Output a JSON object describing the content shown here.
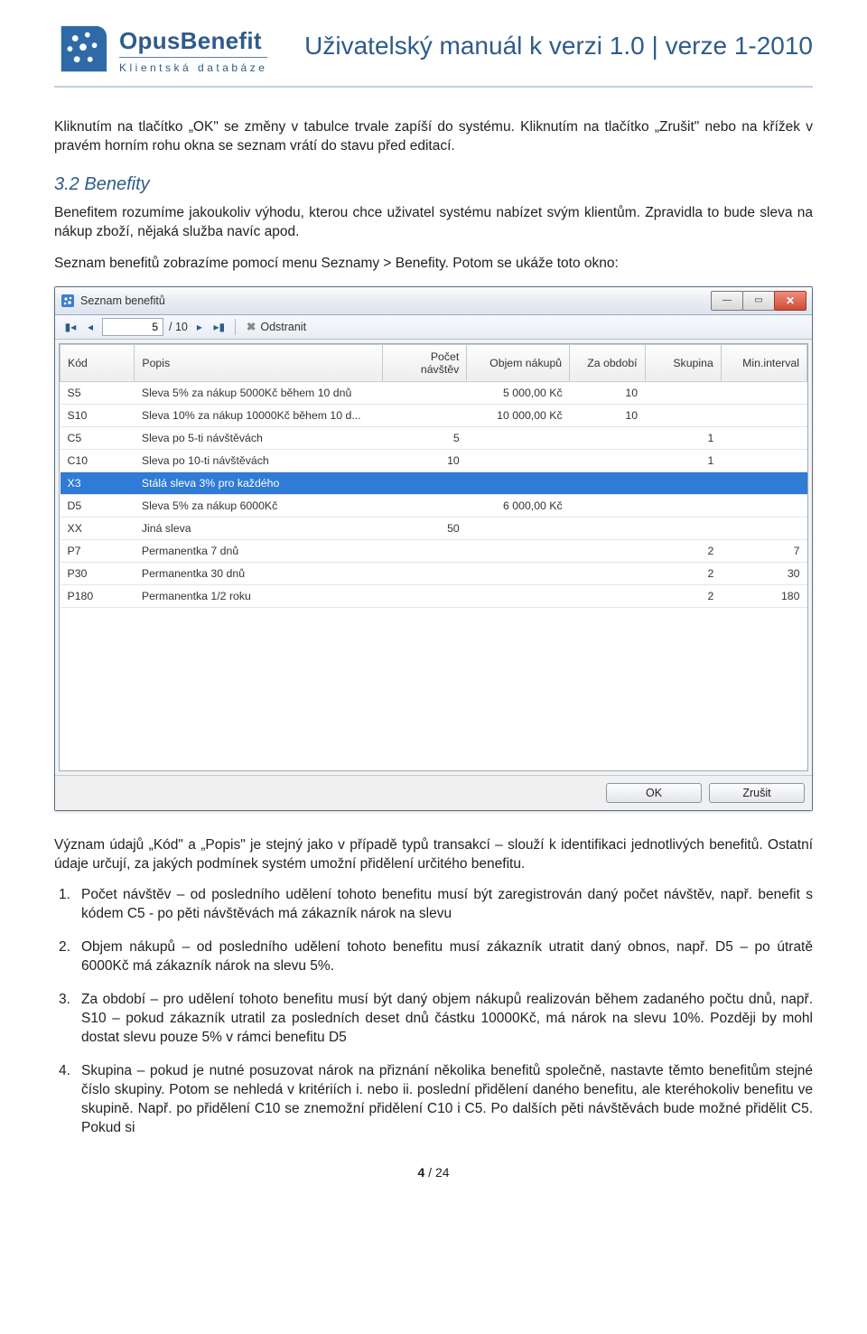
{
  "header": {
    "logo_title": "OpusBenefit",
    "logo_sub": "Klientská databáze",
    "doc_title": "Uživatelský manuál k verzi 1.0 | verze 1-2010"
  },
  "intro_p": "Kliknutím na tlačítko „OK\" se změny v tabulce trvale zapíší do systému. Kliknutím na tlačítko „Zrušit\" nebo na křížek v pravém horním rohu okna se seznam vrátí do stavu před editací.",
  "section": {
    "heading": "3.2 Benefity",
    "p1": "Benefitem rozumíme jakoukoliv výhodu, kterou chce uživatel systému nabízet svým klientům. Zpravidla to bude sleva na nákup zboží, nějaká služba navíc apod.",
    "p2": "Seznam benefitů zobrazíme pomocí menu Seznamy > Benefity. Potom se ukáže toto okno:"
  },
  "window": {
    "title": "Seznam benefitů",
    "nav": {
      "page_value": "5",
      "page_total": "/ 10",
      "remove_label": "Odstranit"
    },
    "columns": [
      "Kód",
      "Popis",
      "Počet návštěv",
      "Objem nákupů",
      "Za období",
      "Skupina",
      "Min.interval"
    ],
    "rows": [
      {
        "kod": "S5",
        "popis": "Sleva 5% za nákup 5000Kč během 10 dnů",
        "pocet": "",
        "objem": "5 000,00 Kč",
        "za": "10",
        "sk": "",
        "min": ""
      },
      {
        "kod": "S10",
        "popis": "Sleva 10% za nákup 10000Kč během 10 d...",
        "pocet": "",
        "objem": "10 000,00 Kč",
        "za": "10",
        "sk": "",
        "min": ""
      },
      {
        "kod": "C5",
        "popis": "Sleva po 5-ti návštěvách",
        "pocet": "5",
        "objem": "",
        "za": "",
        "sk": "1",
        "min": ""
      },
      {
        "kod": "C10",
        "popis": "Sleva po 10-ti návštěvách",
        "pocet": "10",
        "objem": "",
        "za": "",
        "sk": "1",
        "min": ""
      },
      {
        "kod": "X3",
        "popis": "Stálá sleva 3% pro každého",
        "pocet": "",
        "objem": "",
        "za": "",
        "sk": "",
        "min": "",
        "selected": true
      },
      {
        "kod": "D5",
        "popis": "Sleva 5% za nákup 6000Kč",
        "pocet": "",
        "objem": "6 000,00 Kč",
        "za": "",
        "sk": "",
        "min": ""
      },
      {
        "kod": "XX",
        "popis": "Jiná sleva",
        "pocet": "50",
        "objem": "",
        "za": "",
        "sk": "",
        "min": ""
      },
      {
        "kod": "P7",
        "popis": "Permanentka 7 dnů",
        "pocet": "",
        "objem": "",
        "za": "",
        "sk": "2",
        "min": "7"
      },
      {
        "kod": "P30",
        "popis": "Permanentka 30 dnů",
        "pocet": "",
        "objem": "",
        "za": "",
        "sk": "2",
        "min": "30"
      },
      {
        "kod": "P180",
        "popis": "Permanentka 1/2 roku",
        "pocet": "",
        "objem": "",
        "za": "",
        "sk": "2",
        "min": "180"
      }
    ],
    "ok_label": "OK",
    "cancel_label": "Zrušit"
  },
  "after_p": "Význam údajů „Kód\" a „Popis\" je stejný jako v případě typů transakcí – slouží k identifikaci jednotlivých benefitů. Ostatní údaje určují, za jakých podmínek systém umožní přidělení určitého benefitu.",
  "list": [
    "Počet návštěv – od posledního udělení tohoto benefitu musí být zaregistrován daný počet návštěv, např. benefit s kódem C5 - po pěti návštěvách má zákazník nárok na slevu",
    "Objem nákupů – od posledního udělení tohoto benefitu musí zákazník utratit daný obnos, např. D5 – po útratě 6000Kč má zákazník nárok na slevu 5%.",
    "Za období – pro udělení tohoto benefitu musí být daný objem nákupů realizován během zadaného počtu dnů, např. S10 – pokud zákazník utratil za posledních deset dnů částku 10000Kč, má nárok na slevu 10%. Později by mohl dostat slevu pouze 5% v rámci benefitu D5",
    "Skupina – pokud je nutné posuzovat nárok na přiznání několika benefitů společně, nastavte těmto benefitům stejné číslo skupiny. Potom se nehledá v kritériích i. nebo ii. poslední přidělení daného benefitu, ale kteréhokoliv benefitu ve skupině. Např. po přidělení C10 se znemožní přidělení C10 i C5. Po dalších pěti návštěvách bude možné přidělit C5. Pokud si"
  ],
  "footer": {
    "cur": "4",
    "total": "24"
  }
}
